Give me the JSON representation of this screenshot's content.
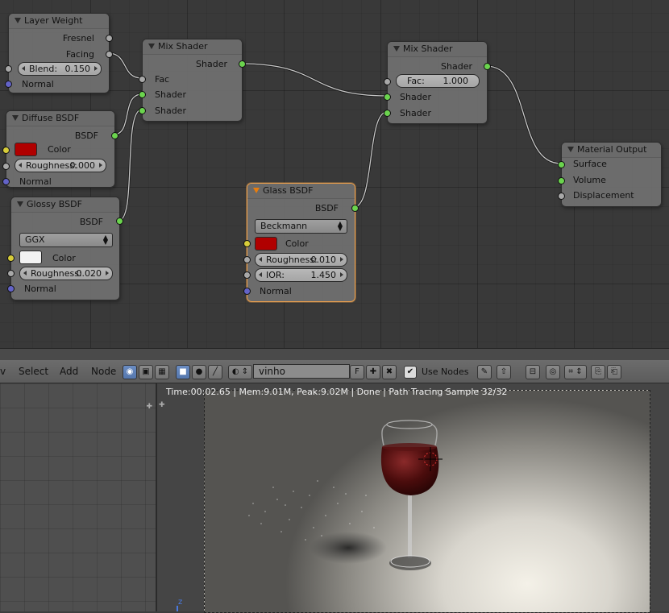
{
  "nodes": {
    "layer_weight": {
      "title": "Layer Weight",
      "out_fresnel": "Fresnel",
      "out_facing": "Facing",
      "blend_key": "Blend:",
      "blend_val": "0.150",
      "in_normal": "Normal"
    },
    "diffuse": {
      "title": "Diffuse BSDF",
      "out": "BSDF",
      "color_label": "Color",
      "rough_key": "Roughness:",
      "rough_val": "0.000",
      "in_normal": "Normal"
    },
    "glossy": {
      "title": "Glossy BSDF",
      "out": "BSDF",
      "distribution": "GGX",
      "color_label": "Color",
      "rough_key": "Roughness:",
      "rough_val": "0.020",
      "in_normal": "Normal"
    },
    "mix1": {
      "title": "Mix Shader",
      "out": "Shader",
      "in_fac": "Fac",
      "in_shader1": "Shader",
      "in_shader2": "Shader"
    },
    "mix2": {
      "title": "Mix Shader",
      "out": "Shader",
      "fac_key": "Fac:",
      "fac_val": "1.000",
      "in_shader1": "Shader",
      "in_shader2": "Shader"
    },
    "glass": {
      "title": "Glass BSDF",
      "out": "BSDF",
      "distribution": "Beckmann",
      "color_label": "Color",
      "rough_key": "Roughness:",
      "rough_val": "0.010",
      "ior_key": "IOR:",
      "ior_val": "1.450",
      "in_normal": "Normal"
    },
    "output": {
      "title": "Material Output",
      "in_surface": "Surface",
      "in_volume": "Volume",
      "in_displacement": "Displacement"
    }
  },
  "colors": {
    "diffuse_color": "#b00000",
    "glossy_color": "#f2f2f2",
    "glass_color": "#b00000",
    "socket_shader": "#6bd44e",
    "socket_float": "#a8a8a8",
    "socket_color": "#d7cd3a",
    "socket_vector": "#6363c7",
    "selected_outline": "#f0a14b"
  },
  "header": {
    "menu_view_partial": "v",
    "menu_select": "Select",
    "menu_add": "Add",
    "menu_node": "Node",
    "material_name": "vinho",
    "fake_user": "F",
    "use_nodes_label": "Use Nodes",
    "use_nodes_checked": true
  },
  "render": {
    "status": "Time:00:02.65 | Mem:9.01M, Peak:9.02M | Done | Path Tracing Sample 32/32",
    "axis_label": "z"
  }
}
